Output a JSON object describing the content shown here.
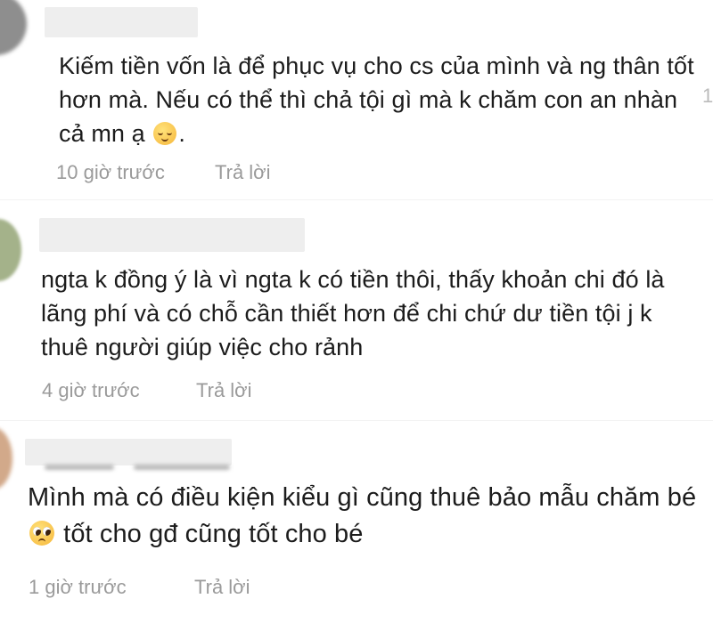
{
  "comments": [
    {
      "text_before_emoji": "Kiếm tiền vốn là để phục vụ cho cs của mình và ng thân tốt hơn mà. Nếu có thể thì chả tội gì mà k chăm con an nhàn cả mn ạ ",
      "emoji": "relieved-face",
      "text_after_emoji": ".",
      "time": "10 giờ trước",
      "reply_label": "Trả lời"
    },
    {
      "text": "ngta k đồng ý là vì ngta k có tiền thôi, thấy khoản chi đó là lãng phí và có chỗ cần thiết hơn để chi chứ dư tiền tội j k thuê người giúp việc cho rảnh",
      "time": "4 giờ trước",
      "reply_label": "Trả lời"
    },
    {
      "text_before_emoji": "Mình mà có điều kiện kiểu gì cũng thuê bảo mẫu chăm bé ",
      "emoji": "pleading-face",
      "text_after_emoji": " tốt cho gđ cũng tốt cho bé",
      "time": "1 giờ trước",
      "reply_label": "Trả lời"
    }
  ],
  "edge_text": "1",
  "colors": {
    "text": "#1c1c1c",
    "meta": "#9a9a9a",
    "redaction": "#eeeeee"
  }
}
